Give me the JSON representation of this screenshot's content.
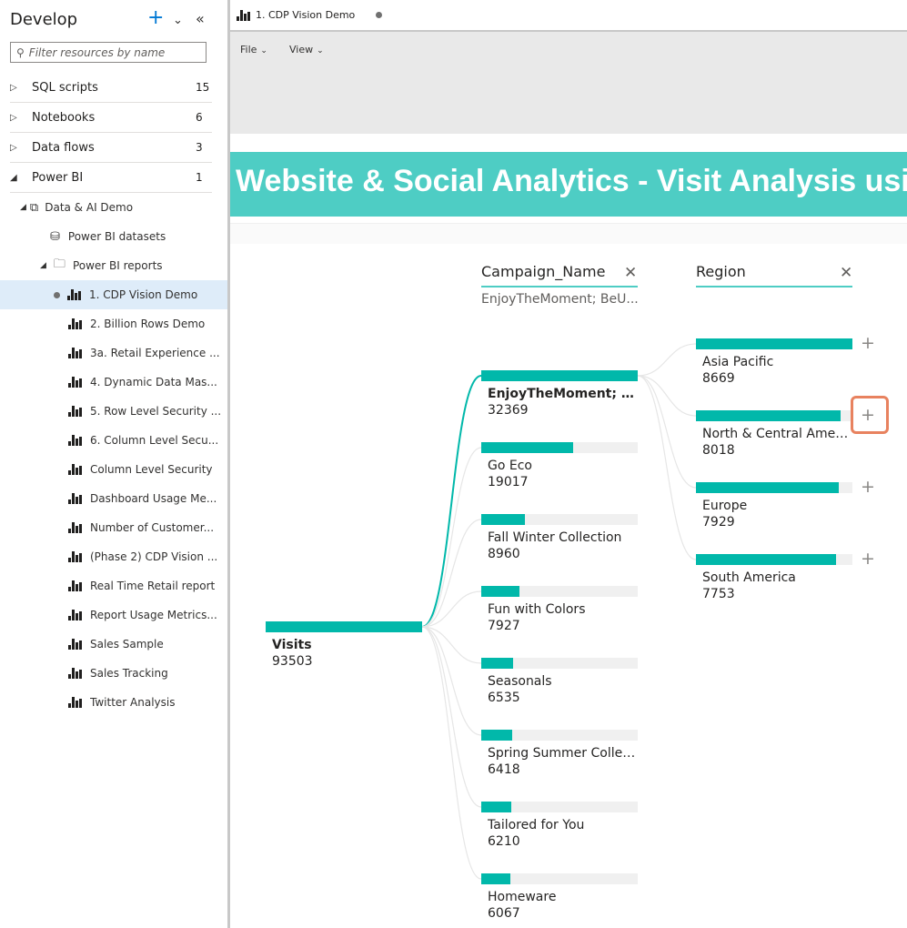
{
  "sidebar": {
    "title": "Develop",
    "filter_placeholder": "Filter resources by name",
    "sections": [
      {
        "label": "SQL scripts",
        "count": "15"
      },
      {
        "label": "Notebooks",
        "count": "6"
      },
      {
        "label": "Data flows",
        "count": "3"
      },
      {
        "label": "Power BI",
        "count": "1"
      }
    ],
    "workspace": "Data & AI Demo",
    "datasets": "Power BI datasets",
    "reports_folder": "Power BI reports",
    "reports": [
      "1. CDP Vision Demo",
      "2. Billion Rows Demo",
      "3a. Retail Experience ...",
      "4. Dynamic Data Mas...",
      "5. Row Level Security ...",
      "6. Column Level Secu...",
      "Column Level Security",
      "Dashboard Usage Me...",
      "Number of Customer...",
      "(Phase 2) CDP Vision ...",
      "Real Time Retail report",
      "Report Usage Metrics...",
      "Sales Sample",
      "Sales Tracking",
      "Twitter Analysis"
    ]
  },
  "tab": {
    "label": "1. CDP Vision Demo"
  },
  "menu": {
    "file": "File",
    "view": "View"
  },
  "report": {
    "title": "Website & Social Analytics - Visit Analysis using",
    "colors": {
      "accent": "#4ecdc4",
      "bar": "#01b8aa",
      "highlight": "#e8825f"
    }
  },
  "chart_data": {
    "type": "decomposition_tree",
    "root": {
      "label": "Visits",
      "value": 93503
    },
    "levels": [
      {
        "field": "Campaign_Name",
        "selected": "EnjoyTheMoment; BeU...",
        "nodes": [
          {
            "label": "EnjoyTheMoment; B...",
            "value": 32369
          },
          {
            "label": "Go Eco",
            "value": 19017
          },
          {
            "label": "Fall Winter Collection",
            "value": 8960
          },
          {
            "label": "Fun with Colors",
            "value": 7927
          },
          {
            "label": "Seasonals",
            "value": 6535
          },
          {
            "label": "Spring Summer Collec...",
            "value": 6418
          },
          {
            "label": "Tailored for You",
            "value": 6210
          },
          {
            "label": "Homeware",
            "value": 6067
          }
        ]
      },
      {
        "field": "Region",
        "nodes": [
          {
            "label": "Asia Pacific",
            "value": 8669
          },
          {
            "label": "North & Central Ameri...",
            "value": 8018
          },
          {
            "label": "Europe",
            "value": 7929
          },
          {
            "label": "South America",
            "value": 7753
          }
        ]
      }
    ]
  }
}
